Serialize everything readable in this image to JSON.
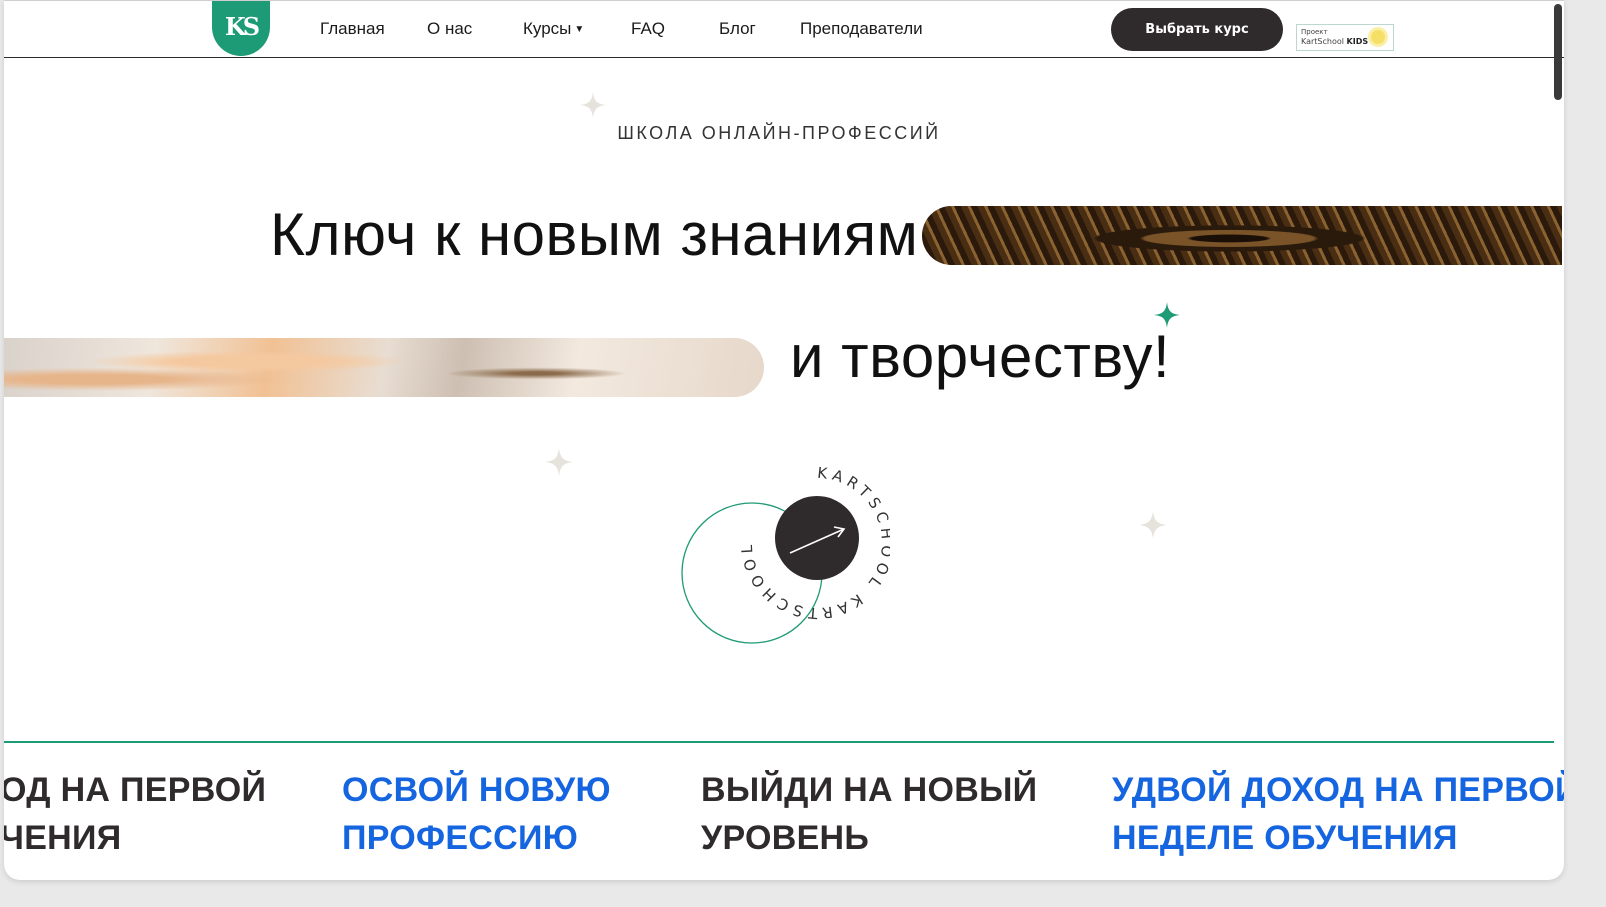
{
  "header": {
    "logo_text": "KS",
    "nav": [
      {
        "label": "Главная"
      },
      {
        "label": "О нас"
      },
      {
        "label": "Курсы",
        "has_dropdown": true
      },
      {
        "label": "FAQ"
      },
      {
        "label": "Блог"
      },
      {
        "label": "Преподаватели"
      }
    ],
    "cta_label": "Выбрать курс",
    "kids_badge": {
      "line1": "Проект",
      "line2_prefix": "KartSchool",
      "line2_bold": "KIDS"
    }
  },
  "hero": {
    "eyebrow": "ШКОЛА ОНЛАЙН-ПРОФЕССИЙ",
    "title_line1": "Ключ к новым знаниям",
    "title_line2": "и творчеству!",
    "badge_ring_text": "KARTSCHOOL KARTSCHOOL",
    "badge_icon": "arrow-up-right-icon"
  },
  "ticker": [
    {
      "line1": "ОД НА ПЕРВОЙ",
      "line2": "ЧЕНИЯ",
      "color": "#2f2a2b"
    },
    {
      "line1": "ОСВОЙ НОВУЮ",
      "line2": "ПРОФЕССИЮ",
      "color": "#1565e0"
    },
    {
      "line1": "ВЫЙДИ НА НОВЫЙ",
      "line2": "УРОВЕНЬ",
      "color": "#2f2a2b"
    },
    {
      "line1": "УДВОЙ ДОХОД НА ПЕРВОЙ",
      "line2": "НЕДЕЛЕ ОБУЧЕНИЯ",
      "color": "#1565e0"
    }
  ],
  "colors": {
    "brand_green": "#1d9a76",
    "dark": "#2f2a2b",
    "accent_blue": "#1565e0"
  }
}
